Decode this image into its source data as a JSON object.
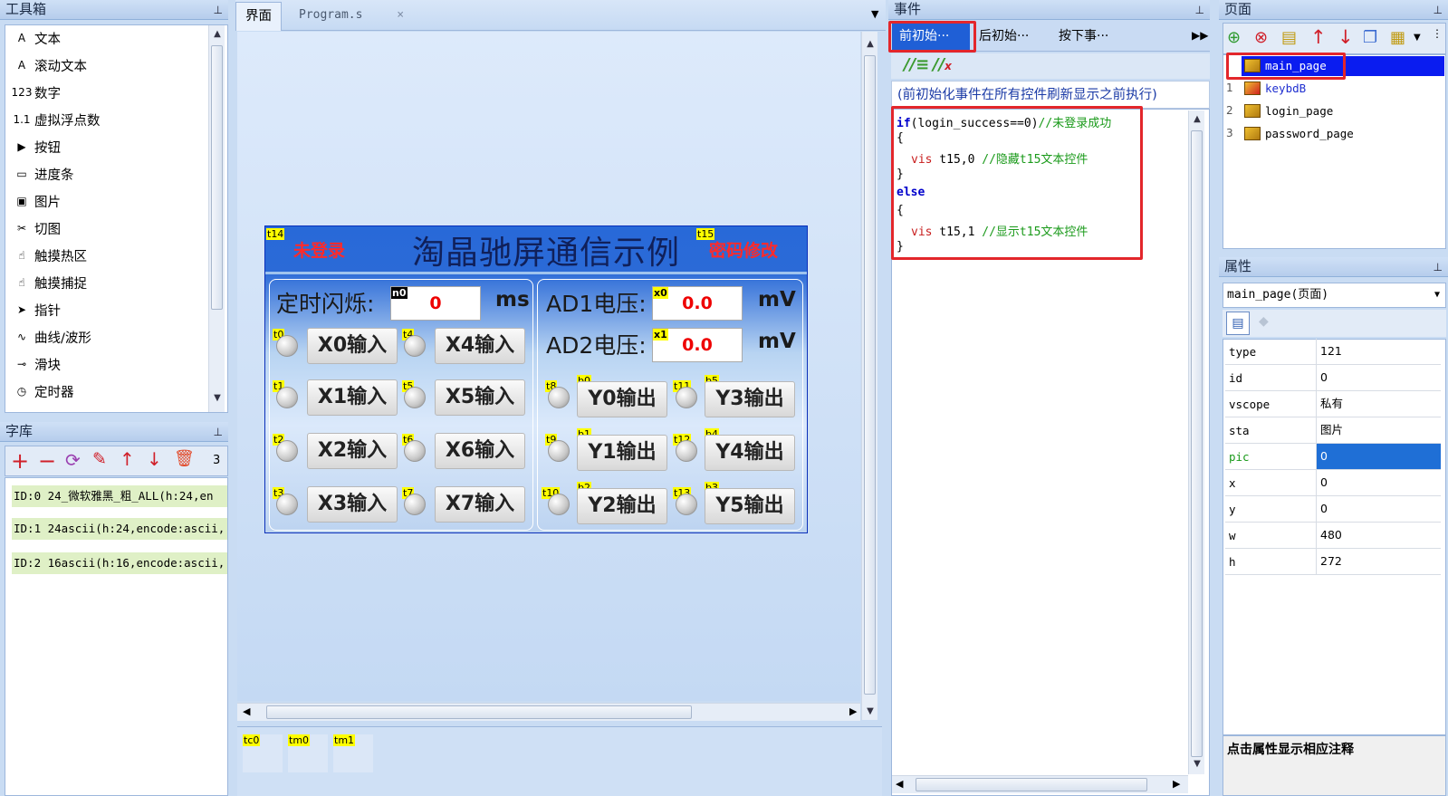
{
  "toolbox": {
    "title": "工具箱",
    "items": [
      {
        "icon": "text-icon",
        "glyph": "A",
        "label": "文本"
      },
      {
        "icon": "scroll-text-icon",
        "glyph": "A",
        "label": "滚动文本"
      },
      {
        "icon": "number-icon",
        "glyph": "123",
        "label": "数字"
      },
      {
        "icon": "float-icon",
        "glyph": "1.1",
        "label": "虚拟浮点数"
      },
      {
        "icon": "button-icon",
        "glyph": "▶",
        "label": "按钮"
      },
      {
        "icon": "progress-icon",
        "glyph": "▭",
        "label": "进度条"
      },
      {
        "icon": "picture-icon",
        "glyph": "▣",
        "label": "图片"
      },
      {
        "icon": "crop-icon",
        "glyph": "✂",
        "label": "切图"
      },
      {
        "icon": "touch-area-icon",
        "glyph": "☝",
        "label": "触摸热区"
      },
      {
        "icon": "touch-capture-icon",
        "glyph": "☝",
        "label": "触摸捕捉"
      },
      {
        "icon": "pointer-icon",
        "glyph": "➤",
        "label": "指针"
      },
      {
        "icon": "waveform-icon",
        "glyph": "∿",
        "label": "曲线/波形"
      },
      {
        "icon": "slider-icon",
        "glyph": "⊸",
        "label": "滑块"
      },
      {
        "icon": "timer-icon",
        "glyph": "◷",
        "label": "定时器"
      }
    ]
  },
  "fontlib": {
    "title": "字库",
    "count": "3",
    "rows": [
      "ID:0  24_微软雅黑_粗_ALL(h:24,en",
      "ID:1  24ascii(h:24,encode:ascii,",
      "ID:2  16ascii(h:16,encode:ascii,"
    ]
  },
  "editor": {
    "tabs": [
      "界面",
      "Program.s"
    ],
    "tab_close": "×",
    "timers": [
      "tc0",
      "tm0",
      "tm1"
    ]
  },
  "hmi": {
    "title": "淘晶驰屏通信示例",
    "login_status": "未登录",
    "password_change": "密码修改",
    "tags": {
      "t14": "t14",
      "t15": "t15",
      "n0": "n0",
      "x0": "x0",
      "x1": "x1",
      "t0": "t0",
      "t1": "t1",
      "t2": "t2",
      "t3": "t3",
      "t4": "t4",
      "t5": "t5",
      "t6": "t6",
      "t7": "t7",
      "t8": "t8",
      "t9": "t9",
      "t10": "t10",
      "t11": "t11",
      "t12": "t12",
      "t13": "t13",
      "b0": "b0",
      "b1": "b1",
      "b2": "b2",
      "b3": "b3",
      "b4": "b4",
      "b5": "b5"
    },
    "blink_label": "定时闪烁:",
    "blink_value": "0",
    "blink_unit": "ms",
    "ad1_label": "AD1电压:",
    "ad1_value": "0.0",
    "ad2_label": "AD2电压:",
    "ad2_value": "0.0",
    "mv_unit": "mV",
    "inputs": [
      "X0输入",
      "X1输入",
      "X2输入",
      "X3输入",
      "X4输入",
      "X5输入",
      "X6输入",
      "X7输入"
    ],
    "outputs": [
      "Y0输出",
      "Y1输出",
      "Y2输出",
      "Y3输出",
      "Y4输出",
      "Y5输出"
    ]
  },
  "events": {
    "title": "事件",
    "tabs": [
      "前初始···",
      "后初始···",
      "按下事···"
    ],
    "hint": "(前初始化事件在所有控件刷新显示之前执行)",
    "code": {
      "l1_kw": "if",
      "l1_rest": "(login_success==0)",
      "l1_comment": "//未登录成功",
      "l2": "{",
      "l3_cmd": "vis",
      "l3_args": " t15,0 ",
      "l3_comment": "//隐藏t15文本控件",
      "l4": "}",
      "l5_kw": "else",
      "l6": "{",
      "l7_cmd": "vis",
      "l7_args": " t15,1 ",
      "l7_comment": "//显示t15文本控件",
      "l8": "}"
    }
  },
  "pages": {
    "title": "页面",
    "items": [
      {
        "index": "",
        "name": "main_page"
      },
      {
        "index": "1",
        "name": "keybdB"
      },
      {
        "index": "2",
        "name": "login_page"
      },
      {
        "index": "3",
        "name": "password_page"
      }
    ]
  },
  "properties": {
    "title": "属性",
    "selector": "main_page(页面)",
    "rows": [
      {
        "key": "type",
        "value": "121"
      },
      {
        "key": "id",
        "value": "0"
      },
      {
        "key": "vscope",
        "value": "私有"
      },
      {
        "key": "sta",
        "value": "图片"
      },
      {
        "key": "pic",
        "value": "0"
      },
      {
        "key": "x",
        "value": "0"
      },
      {
        "key": "y",
        "value": "0"
      },
      {
        "key": "w",
        "value": "480"
      },
      {
        "key": "h",
        "value": "272"
      }
    ],
    "hint": "点击属性显示相应注释"
  },
  "colors": {
    "accent": "#1f5fd6",
    "highlight_red": "#e3262b",
    "selection_blue": "#0a1cf0",
    "font_row_green": "#dff0c6",
    "comment_green": "#1a9a1a",
    "keyword_blue": "#0000cc",
    "cmd_red": "#c81e1e"
  },
  "pin_glyph": "⊥"
}
